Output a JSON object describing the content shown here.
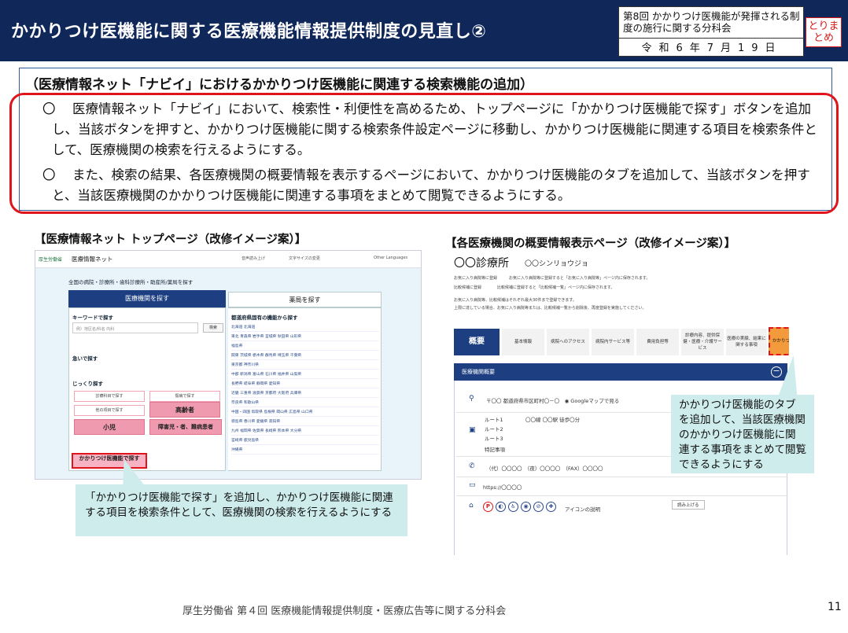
{
  "header": {
    "title": "かかりつけ医機能に関する医療機能情報提供制度の見直し②",
    "meeting_name": "第8回 かかりつけ医機能が発揮される制度の施行に関する分科会",
    "meeting_date": "令和6年7月19日",
    "summary_badge": "とりまとめ"
  },
  "section": {
    "heading": "（医療情報ネット「ナビイ」におけるかかりつけ医機能に関連する検索機能の追加）",
    "paragraphs": [
      {
        "mark": "〇",
        "text": "医療情報ネット「ナビイ」において、検索性・利便性を高めるため、トップページに「かかりつけ医機能で探す」ボタンを追加し、当該ボタンを押すと、かかりつけ医機能に関する検索条件設定ページに移動し、かかりつけ医機能に関連する項目を検索条件として、医療機関の検索を行えるようにする。"
      },
      {
        "mark": "〇",
        "text": "また、検索の結果、各医療機関の概要情報を表示するページにおいて、かかりつけ医機能のタブを追加して、当該ボタンを押すと、当該医療機関のかかりつけ医機能に関連する事項をまとめて閲覧できるようにする。"
      }
    ]
  },
  "left_panel": {
    "caption": "【医療情報ネット トップページ（改修イメージ案）】",
    "mock": {
      "logo": "厚生労働省",
      "site_name": "医療情報ネット",
      "toolbar": [
        "音声読み上げ",
        "文字サイズの変更",
        "Other Languages"
      ],
      "lead": "全国の病院・診療所・歯科診療所・助産所/薬局を探す",
      "tab_active": "医療機関を探す",
      "tab_inactive": "薬局を探す",
      "keyword_label": "キーワードで探す",
      "keyword_placeholder": "例）地区名/科名 内科",
      "search_button": "検索",
      "urgent_label": "急いで探す",
      "detailed_label": "じっくり探す",
      "pref_label": "都道府県固有の機能から探す",
      "small_chips": [
        "診療科目で探す",
        "傷病で探す",
        "他の項目で探す"
      ],
      "big_chips": [
        "高齢者",
        "小児",
        "障害児・者、難病患者"
      ],
      "highlight_chip": "かかりつけ医機能で探す",
      "pref_rows": [
        "北海道  北海道",
        "東北  青森県 岩手県 宮城県 秋田県 山形県",
        "福島県",
        "関東  茨城県 栃木県 群馬県 埼玉県 千葉県",
        "東京都 神奈川県",
        "中部  新潟県 富山県 石川県 福井県 山梨県",
        "長野県 岐阜県 静岡県 愛知県",
        "近畿  三重県 滋賀県 京都府 大阪府 兵庫県",
        "奈良県 和歌山県",
        "中国・四国  鳥取県 島根県 岡山県 広島県 山口県",
        "徳島県 香川県 愛媛県 高知県",
        "九州  福岡県 佐賀県 長崎県 熊本県 大分県",
        "宮崎県 鹿児島県",
        "沖縄県"
      ]
    },
    "callout": "「かかりつけ医機能で探す」を追加し、かかりつけ医機能に関連する項目を検索条件として、医療機関の検索を行えるようにする"
  },
  "right_panel": {
    "caption": "【各医療機関の概要情報表示ページ（改修イメージ案）】",
    "mock": {
      "clinic_name": "〇〇診療所",
      "clinic_kana": "〇〇シンリョウジョ",
      "links": [
        "お気に入り病院等に登録　　　お気に入り病院等に登録すると「お気に入り病院等」ページ内に保存されます。",
        "比較候補に登録　　　　比較候補に登録すると「比較候補一覧」ページ内に保存されます。",
        "お気に入り病院等、比較候補はそれぞれ最大30件まで登録できます。",
        "上限に達している場合、お気に入り病院等または、比較候補一覧から削除後、再度登録を実施してください。"
      ],
      "tabs": [
        "概要",
        "基本情報",
        "病院へのアクセス",
        "病院内サービス等",
        "費用負担等",
        "診療内容、提供保健・医療・介護サービス",
        "医療の実績、結果に関する事項",
        "かかりつけ医機能"
      ],
      "section_bar": "医療機関概要",
      "address": "〒〇〇 都道府県市区町村〇－〇　◉ Googleマップで見る",
      "routes": [
        "ルート1",
        "ルート2",
        "ルート3",
        "特記事項"
      ],
      "route_detail": "〇〇線 〇〇駅 徒歩〇分",
      "phone": "（代）〇〇〇〇　（夜）〇〇〇〇　（FAX）〇〇〇〇",
      "url": "https://〇〇〇〇",
      "icons_label": "アイコンの説明",
      "read_aloud": "読み上げる"
    },
    "callout": "かかりつけ医機能のタブを追加して、当該医療機関のかかりつけ医機能に関連する事項をまとめて閲覧できるようにする"
  },
  "footer": {
    "text": "厚生労働省 第４回 医療機能情報提供制度・医療広告等に関する分科会",
    "page_number": "11"
  },
  "colors": {
    "header_bg": "#10275a",
    "accent_red": "#e0151b",
    "callout_bg": "#cdeceb",
    "nav_blue": "#1d3f82",
    "highlight_orange": "#f39a3c"
  }
}
